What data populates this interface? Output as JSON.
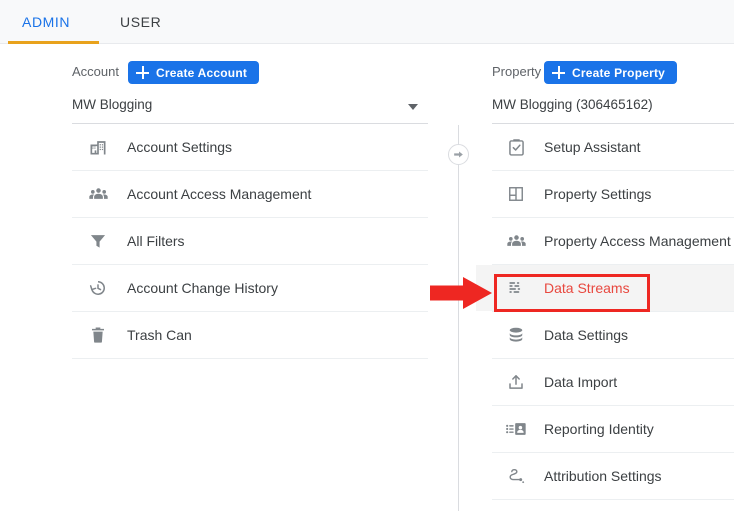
{
  "tabs": [
    {
      "label": "ADMIN",
      "active": true
    },
    {
      "label": "USER",
      "active": false
    }
  ],
  "account_column": {
    "header_label": "Account",
    "create_button_label": "Create Account",
    "selected_account": "MW Blogging",
    "items": [
      {
        "label": "Account Settings",
        "icon": "building-icon"
      },
      {
        "label": "Account Access Management",
        "icon": "people-group-icon"
      },
      {
        "label": "All Filters",
        "icon": "funnel-icon"
      },
      {
        "label": "Account Change History",
        "icon": "history-clock-icon"
      },
      {
        "label": "Trash Can",
        "icon": "trash-can-icon"
      }
    ]
  },
  "property_column": {
    "header_label": "Property",
    "create_button_label": "Create Property",
    "selected_property": "MW Blogging (306465162)",
    "items": [
      {
        "label": "Setup Assistant",
        "icon": "clipboard-check-icon",
        "highlighted": false
      },
      {
        "label": "Property Settings",
        "icon": "layout-panel-icon",
        "highlighted": false
      },
      {
        "label": "Property Access Management",
        "icon": "people-group-icon",
        "highlighted": false
      },
      {
        "label": "Data Streams",
        "icon": "data-streams-icon",
        "highlighted": true
      },
      {
        "label": "Data Settings",
        "icon": "database-icon",
        "highlighted": false
      },
      {
        "label": "Data Import",
        "icon": "upload-icon",
        "highlighted": false
      },
      {
        "label": "Reporting Identity",
        "icon": "reporting-identity-icon",
        "highlighted": false
      },
      {
        "label": "Attribution Settings",
        "icon": "attribution-path-icon",
        "highlighted": false
      }
    ]
  },
  "divider": {
    "toggle_icon": "arrow-right-circle-icon"
  },
  "annotation": {
    "target_label": "Data Streams",
    "shape": "rectangle-outline-with-arrow",
    "color": "#ee2722"
  },
  "colors": {
    "accent_blue": "#1a73e8",
    "tab_underline": "#e8a21c",
    "annotation_red": "#ee2722",
    "tabbar_background": "#f8f9fa",
    "row_hover": "#f4f4f4",
    "text_primary": "#3c4043",
    "text_secondary": "#5f6368"
  }
}
